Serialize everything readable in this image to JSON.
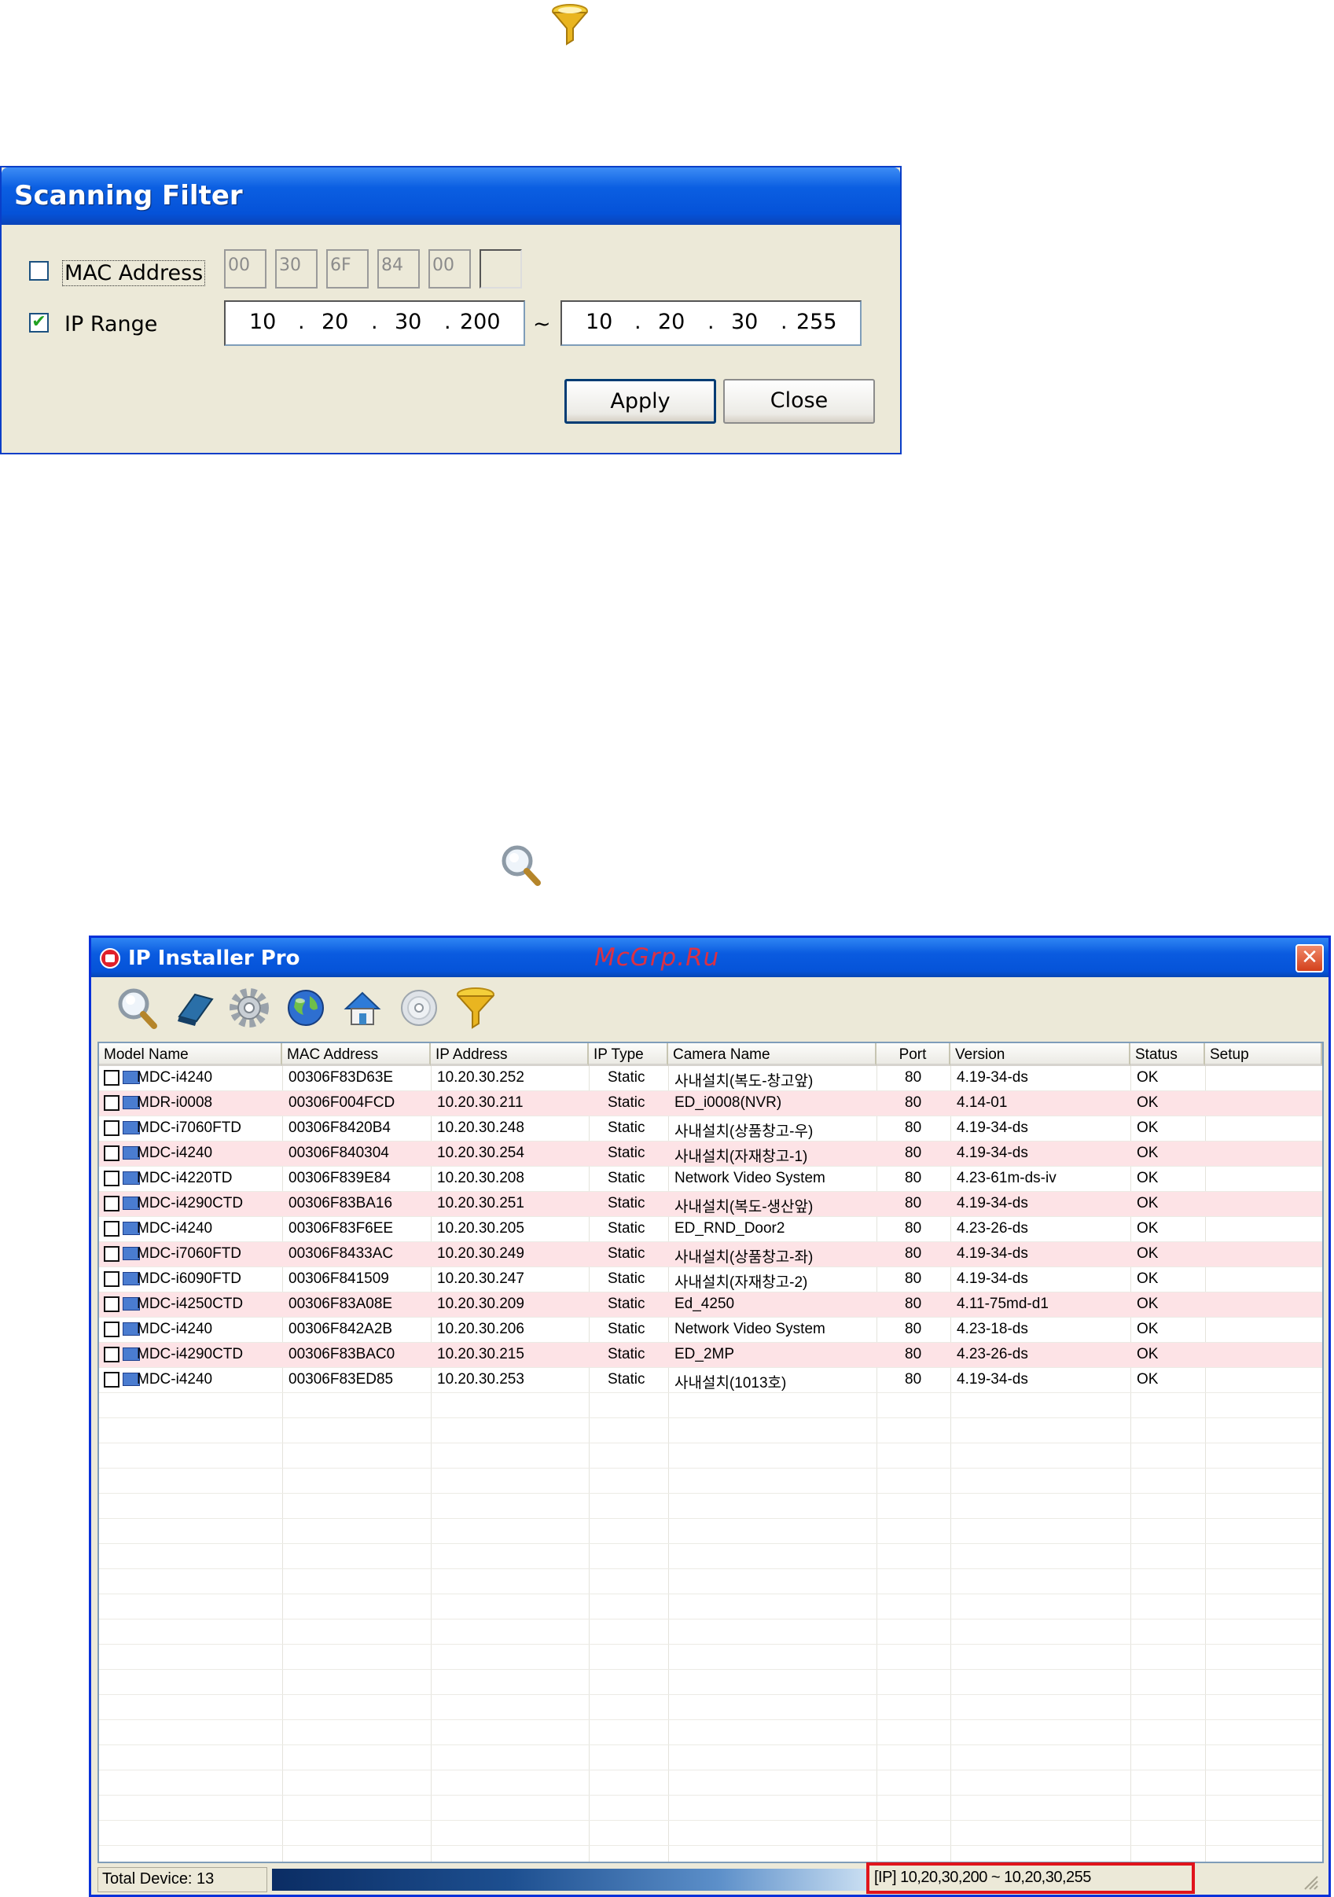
{
  "filter_icon": "funnel-icon",
  "search_icon": "magnifier-icon",
  "scanning_filter": {
    "title": "Scanning Filter",
    "mac_checked": false,
    "mac_label": "MAC Address",
    "mac_bytes": [
      "00",
      "30",
      "6F",
      "84",
      "00",
      ""
    ],
    "ip_checked": true,
    "ip_label": "IP Range",
    "ip_from": [
      "10",
      "20",
      "30",
      "200"
    ],
    "range_separator": "~",
    "ip_to": [
      "10",
      "20",
      "30",
      "255"
    ],
    "apply_label": "Apply",
    "close_label": "Close"
  },
  "installer": {
    "title": "IP Installer Pro",
    "watermark": "McGrp.Ru",
    "close_glyph": "✕",
    "toolbar_icons": [
      "search-icon",
      "eraser-icon",
      "gear-icon",
      "globe-icon",
      "home-icon",
      "disc-icon",
      "funnel-icon"
    ],
    "columns": [
      "Model Name",
      "MAC Address",
      "IP Address",
      "IP Type",
      "Camera Name",
      "Port",
      "Version",
      "Status",
      "Setup"
    ],
    "rows": [
      {
        "model": "MDC-i4240",
        "mac": "00306F83D63E",
        "ip": "10.20.30.252",
        "type": "Static",
        "camera": "사내설치(복도-창고앞)",
        "port": "80",
        "version": "4.19-34-ds",
        "status": "OK",
        "setup": ""
      },
      {
        "model": "MDR-i0008",
        "mac": "00306F004FCD",
        "ip": "10.20.30.211",
        "type": "Static",
        "camera": "ED_i0008(NVR)",
        "port": "80",
        "version": "4.14-01",
        "status": "OK",
        "setup": ""
      },
      {
        "model": "MDC-i7060FTD",
        "mac": "00306F8420B4",
        "ip": "10.20.30.248",
        "type": "Static",
        "camera": "사내설치(상품창고-우)",
        "port": "80",
        "version": "4.19-34-ds",
        "status": "OK",
        "setup": ""
      },
      {
        "model": "MDC-i4240",
        "mac": "00306F840304",
        "ip": "10.20.30.254",
        "type": "Static",
        "camera": "사내설치(자재창고-1)",
        "port": "80",
        "version": "4.19-34-ds",
        "status": "OK",
        "setup": ""
      },
      {
        "model": "MDC-i4220TD",
        "mac": "00306F839E84",
        "ip": "10.20.30.208",
        "type": "Static",
        "camera": "Network Video System",
        "port": "80",
        "version": "4.23-61m-ds-iv",
        "status": "OK",
        "setup": ""
      },
      {
        "model": "MDC-i4290CTD",
        "mac": "00306F83BA16",
        "ip": "10.20.30.251",
        "type": "Static",
        "camera": "사내설치(복도-생산앞)",
        "port": "80",
        "version": "4.19-34-ds",
        "status": "OK",
        "setup": ""
      },
      {
        "model": "MDC-i4240",
        "mac": "00306F83F6EE",
        "ip": "10.20.30.205",
        "type": "Static",
        "camera": "ED_RND_Door2",
        "port": "80",
        "version": "4.23-26-ds",
        "status": "OK",
        "setup": ""
      },
      {
        "model": "MDC-i7060FTD",
        "mac": "00306F8433AC",
        "ip": "10.20.30.249",
        "type": "Static",
        "camera": "사내설치(상품창고-좌)",
        "port": "80",
        "version": "4.19-34-ds",
        "status": "OK",
        "setup": ""
      },
      {
        "model": "MDC-i6090FTD",
        "mac": "00306F841509",
        "ip": "10.20.30.247",
        "type": "Static",
        "camera": "사내설치(자재창고-2)",
        "port": "80",
        "version": "4.19-34-ds",
        "status": "OK",
        "setup": ""
      },
      {
        "model": "MDC-i4250CTD",
        "mac": "00306F83A08E",
        "ip": "10.20.30.209",
        "type": "Static",
        "camera": "Ed_4250",
        "port": "80",
        "version": "4.11-75md-d1",
        "status": "OK",
        "setup": ""
      },
      {
        "model": "MDC-i4240",
        "mac": "00306F842A2B",
        "ip": "10.20.30.206",
        "type": "Static",
        "camera": "Network Video System",
        "port": "80",
        "version": "4.23-18-ds",
        "status": "OK",
        "setup": ""
      },
      {
        "model": "MDC-i4290CTD",
        "mac": "00306F83BAC0",
        "ip": "10.20.30.215",
        "type": "Static",
        "camera": "ED_2MP",
        "port": "80",
        "version": "4.23-26-ds",
        "status": "OK",
        "setup": ""
      },
      {
        "model": "MDC-i4240",
        "mac": "00306F83ED85",
        "ip": "10.20.30.253",
        "type": "Static",
        "camera": "사내설치(1013호)",
        "port": "80",
        "version": "4.19-34-ds",
        "status": "OK",
        "setup": ""
      }
    ],
    "status_total": "Total Device: 13",
    "status_range": "[IP]  10,20,30,200 ~ 10,20,30,255",
    "colors": {
      "row_alt": "#fde3e6",
      "title_blue": "#0553d8",
      "highlight_red": "#e0141c"
    }
  }
}
